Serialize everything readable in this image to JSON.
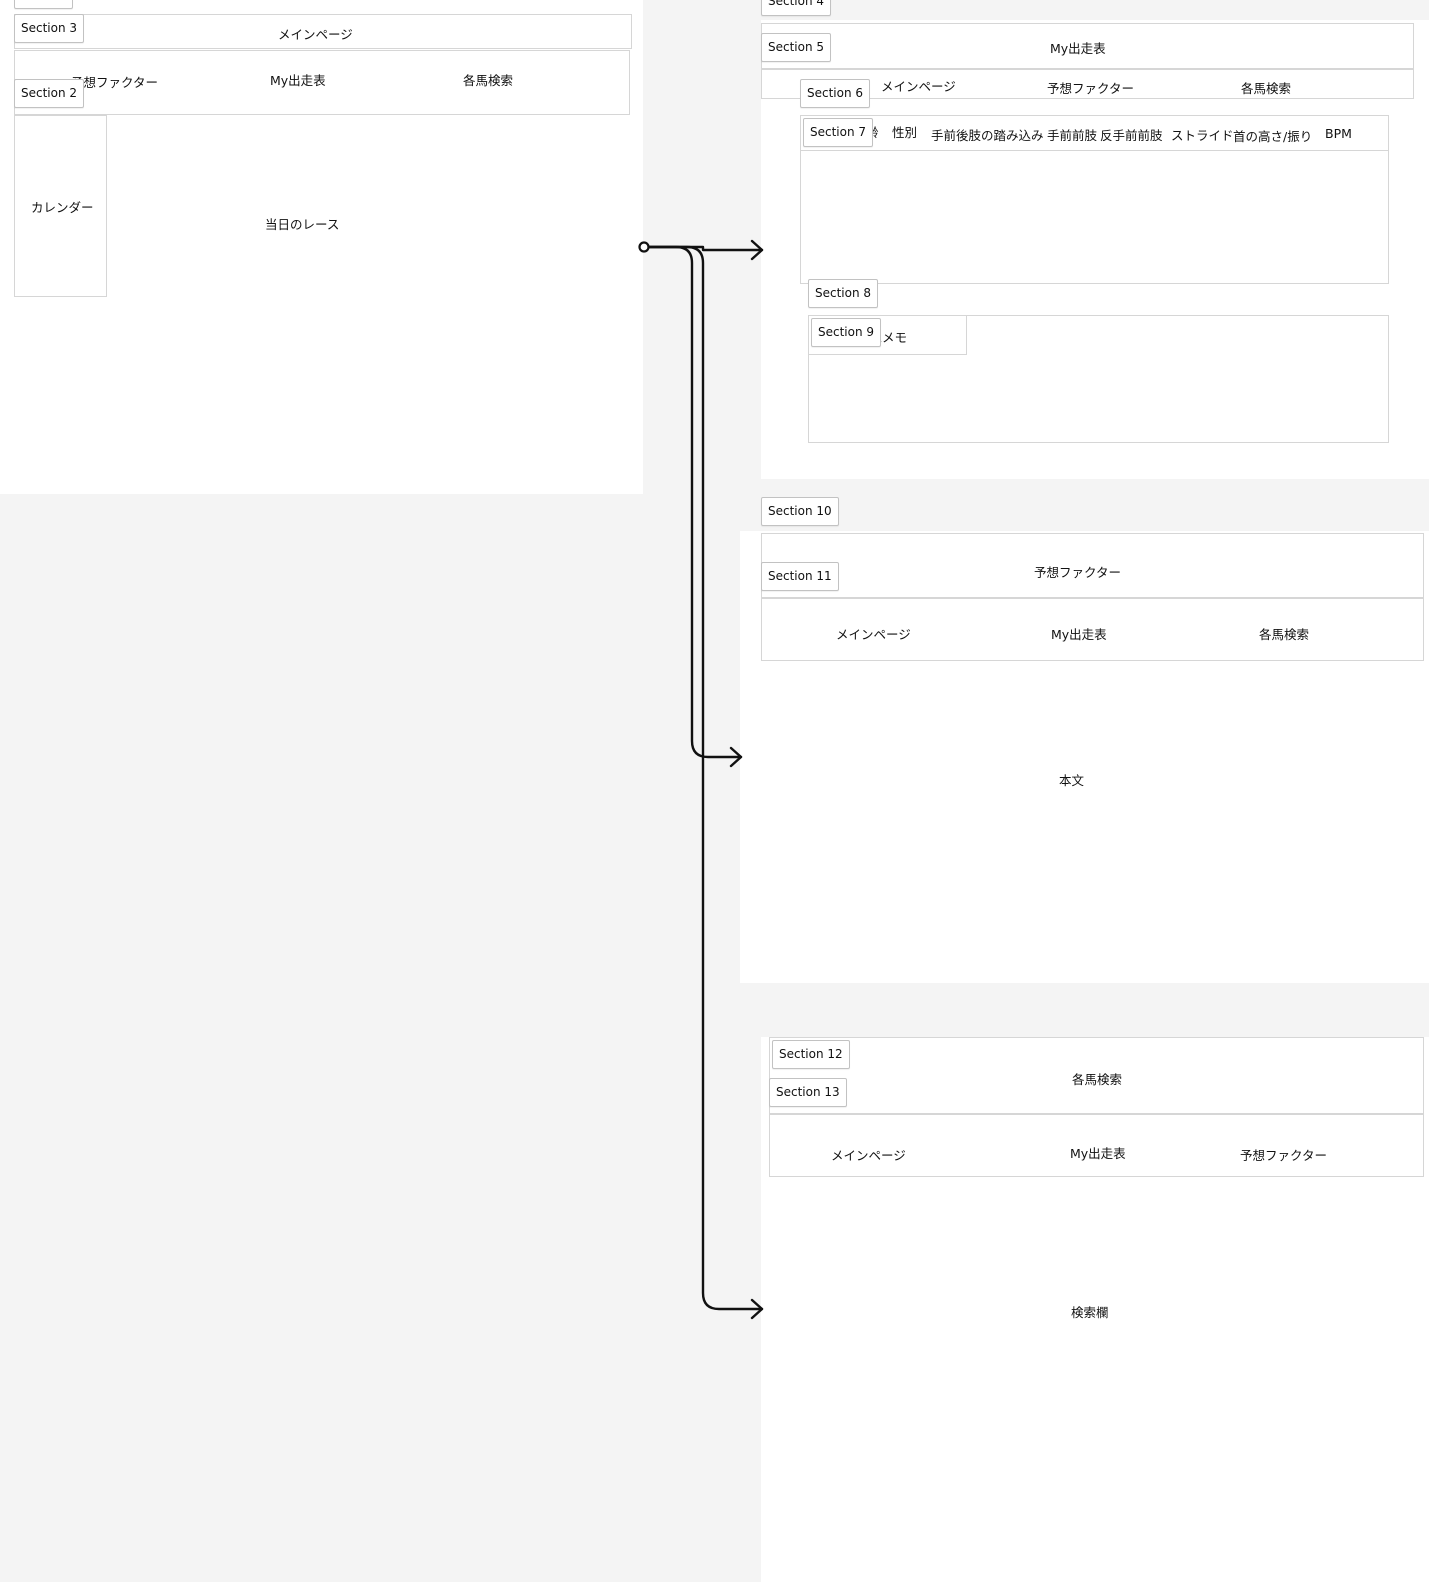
{
  "nav": {
    "main": "メインページ",
    "factor": "予想ファクター",
    "mylist": "My出走表",
    "search": "各馬検索"
  },
  "frame1": {
    "section3": "Section 3",
    "section2": "Section 2",
    "calendar": "カレンダー",
    "today_races": "当日のレース"
  },
  "frame2": {
    "section4": "Section 4",
    "section5": "Section 5",
    "section6": "Section 6",
    "section7": "Section 7",
    "section8": "Section 8",
    "section9": "Section 9",
    "factor_cols": [
      "齢",
      "性別",
      "手前後肢の踏み込み",
      "手前前肢",
      "反手前前肢",
      "ストライド",
      "首の高さ/振り",
      "BPM"
    ],
    "memo": "予想メモ"
  },
  "frame3": {
    "section10": "Section 10",
    "section11": "Section 11",
    "body_text": "本文"
  },
  "frame4": {
    "section12": "Section 12",
    "section13": "Section 13",
    "search_field": "検索欄"
  }
}
